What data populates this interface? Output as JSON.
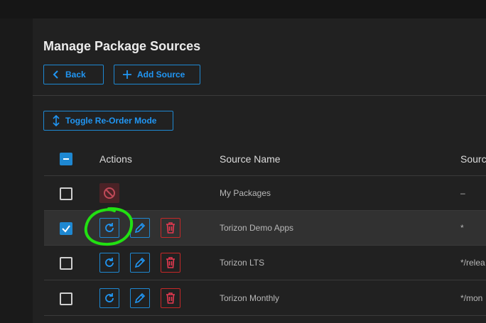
{
  "page": {
    "title": "Manage Package Sources",
    "back_label": "Back",
    "add_source_label": "Add Source",
    "toggle_reorder_label": "Toggle Re-Order Mode"
  },
  "table": {
    "headers": {
      "actions": "Actions",
      "source_name": "Source Name",
      "source_partial": "Sourc"
    },
    "rows": [
      {
        "name": "My Packages",
        "pattern": "–",
        "checked": false,
        "disabled": true
      },
      {
        "name": "Torizon Demo Apps",
        "pattern": "*",
        "checked": true,
        "disabled": false
      },
      {
        "name": "Torizon LTS",
        "pattern": "*/relea",
        "checked": false,
        "disabled": false
      },
      {
        "name": "Torizon Monthly",
        "pattern": "*/mon",
        "checked": false,
        "disabled": false
      }
    ]
  },
  "colors": {
    "accent": "#1e88d2",
    "danger": "#c62828",
    "annotation": "#22e012"
  },
  "icons": [
    "chevron-left-icon",
    "plus-icon",
    "vertical-arrows-icon",
    "minus-icon",
    "check-icon",
    "refresh-icon",
    "pencil-icon",
    "trash-icon",
    "block-icon"
  ]
}
